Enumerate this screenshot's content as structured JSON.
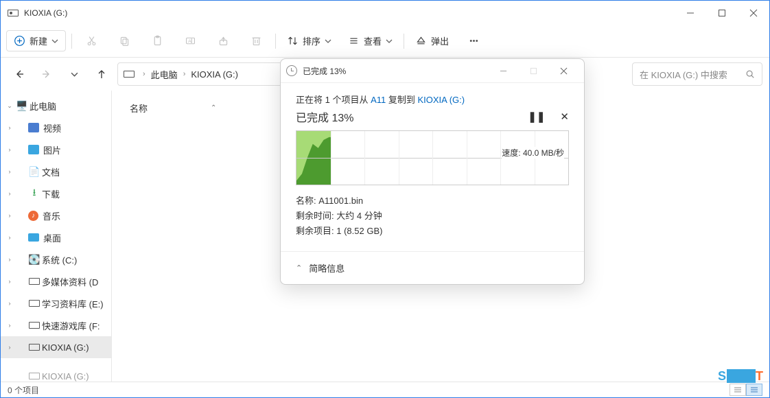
{
  "window": {
    "title": "KIOXIA (G:)"
  },
  "toolbar": {
    "new": "新建",
    "sort": "排序",
    "view": "查看",
    "eject": "弹出"
  },
  "breadcrumb": {
    "pc": "此电脑",
    "drive": "KIOXIA (G:)"
  },
  "search": {
    "placeholder": "在 KIOXIA (G:) 中搜索"
  },
  "sidebar": {
    "pc": "此电脑",
    "items": [
      {
        "label": "视频"
      },
      {
        "label": "图片"
      },
      {
        "label": "文档"
      },
      {
        "label": "下载"
      },
      {
        "label": "音乐"
      },
      {
        "label": "桌面"
      },
      {
        "label": "系统 (C:)"
      },
      {
        "label": "多媒体资料 (D"
      },
      {
        "label": "学习资料库 (E:)"
      },
      {
        "label": "快速游戏库 (F:"
      },
      {
        "label": "KIOXIA (G:)"
      },
      {
        "label": "KIOXIA (G:)"
      }
    ]
  },
  "content": {
    "col_name": "名称"
  },
  "statusbar": {
    "items": "0 个项目"
  },
  "dialog": {
    "title": "已完成 13%",
    "copying_prefix": "正在将 1 个项目从 ",
    "copying_src": "A11",
    "copying_mid": " 复制到 ",
    "copying_dst": "KIOXIA (G:)",
    "progress_label": "已完成 13%",
    "speed": "速度: 40.0 MB/秒",
    "name_lbl": "名称:",
    "name_val": "A11001.bin",
    "time_lbl": "剩余时间:",
    "time_val": "大约 4 分钟",
    "items_lbl": "剩余项目:",
    "items_val": "1 (8.52 GB)",
    "footer": "简略信息"
  },
  "chart_data": {
    "type": "area",
    "title": "Copy transfer rate",
    "ylabel": "MB/秒",
    "progress_percent": 13,
    "current_rate": 40.0,
    "x": [
      0,
      2,
      4,
      6,
      8,
      10,
      12,
      13
    ],
    "values": [
      3,
      8,
      20,
      34,
      30,
      38,
      40,
      40
    ]
  }
}
